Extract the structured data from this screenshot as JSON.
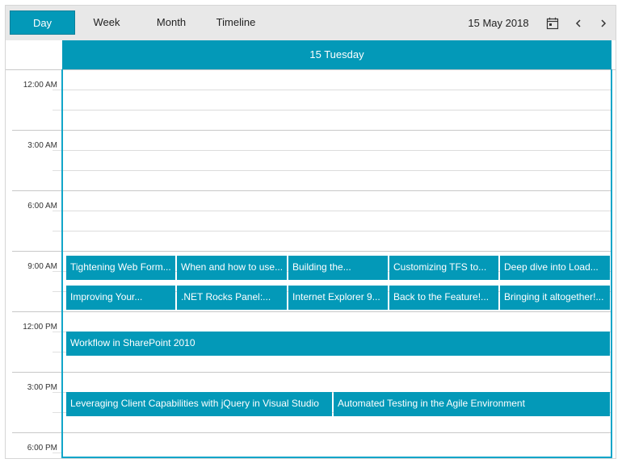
{
  "toolbar": {
    "tabs": {
      "day": "Day",
      "week": "Week",
      "month": "Month",
      "timeline": "Timeline"
    },
    "active_tab": "Day",
    "current_date": "15 May 2018"
  },
  "header": {
    "day": "15 Tuesday"
  },
  "time_labels": {
    "t0": "12:00 AM",
    "t1": "3:00 AM",
    "t2": "6:00 AM",
    "t3": "9:00 AM",
    "t4": "12:00 PM",
    "t5": "3:00 PM",
    "t6": "6:00 PM"
  },
  "appointments": {
    "a1": "Tightening Web Form...",
    "a2": "When and how to use...",
    "a3": "Building the...",
    "a4": "Customizing TFS to...",
    "a5": "Deep dive into Load...",
    "a6": "Improving Your...",
    "a7": ".NET Rocks Panel:...",
    "a8": "Internet Explorer 9...",
    "a9": "Back to the Feature!...",
    "a10": "Bringing it altogether!...",
    "a11": "Workflow in SharePoint 2010",
    "a12": "Leveraging Client Capabilities with jQuery in Visual Studio",
    "a13": "Automated Testing in the Agile Environment"
  },
  "colors": {
    "accent": "#0399b8",
    "border_accent": "#11a5c9",
    "toolbar_bg": "#e8e8e8"
  }
}
